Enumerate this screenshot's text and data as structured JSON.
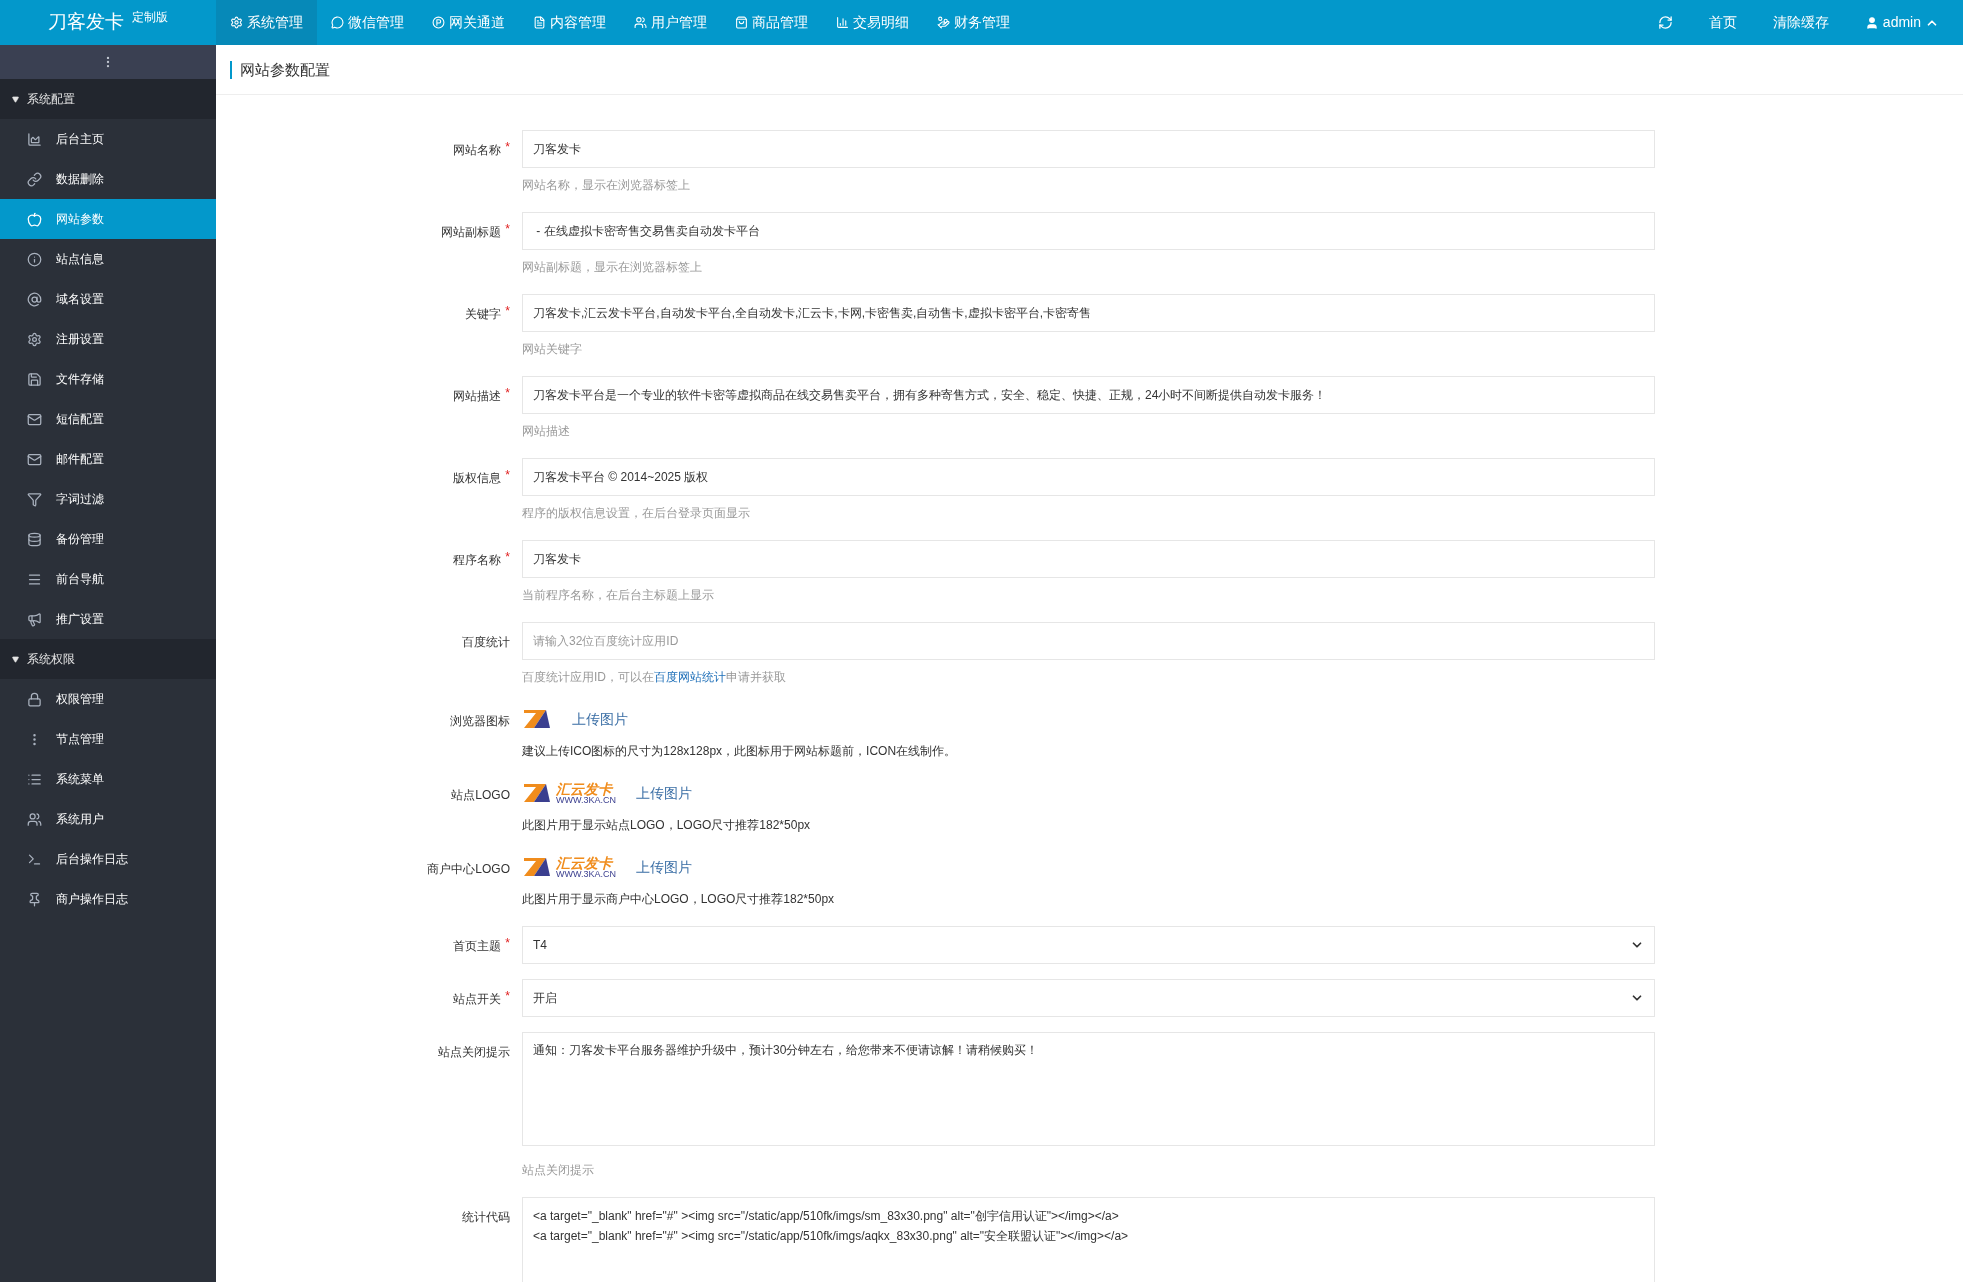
{
  "brand": {
    "name": "刀客发卡",
    "edition": "定制版"
  },
  "top_nav": [
    {
      "label": "系统管理",
      "selected": true
    },
    {
      "label": "微信管理",
      "selected": false
    },
    {
      "label": "网关通道",
      "selected": false
    },
    {
      "label": "内容管理",
      "selected": false
    },
    {
      "label": "用户管理",
      "selected": false
    },
    {
      "label": "商品管理",
      "selected": false
    },
    {
      "label": "交易明细",
      "selected": false
    },
    {
      "label": "财务管理",
      "selected": false
    }
  ],
  "top_right": {
    "home": "首页",
    "clear_cache": "清除缓存",
    "user": "admin"
  },
  "sidebar": [
    {
      "title": "系统配置",
      "expanded": true,
      "items": [
        {
          "label": "后台主页",
          "selected": false
        },
        {
          "label": "数据删除",
          "selected": false
        },
        {
          "label": "网站参数",
          "selected": true
        },
        {
          "label": "站点信息",
          "selected": false
        },
        {
          "label": "域名设置",
          "selected": false
        },
        {
          "label": "注册设置",
          "selected": false
        },
        {
          "label": "文件存储",
          "selected": false
        },
        {
          "label": "短信配置",
          "selected": false
        },
        {
          "label": "邮件配置",
          "selected": false
        },
        {
          "label": "字词过滤",
          "selected": false
        },
        {
          "label": "备份管理",
          "selected": false
        },
        {
          "label": "前台导航",
          "selected": false
        },
        {
          "label": "推广设置",
          "selected": false
        }
      ]
    },
    {
      "title": "系统权限",
      "expanded": true,
      "items": [
        {
          "label": "权限管理",
          "selected": false
        },
        {
          "label": "节点管理",
          "selected": false
        },
        {
          "label": "系统菜单",
          "selected": false
        },
        {
          "label": "系统用户",
          "selected": false
        },
        {
          "label": "后台操作日志",
          "selected": false
        },
        {
          "label": "商户操作日志",
          "selected": false
        }
      ]
    }
  ],
  "page_title": "网站参数配置",
  "form": [
    {
      "kind": "input",
      "label": "网站名称",
      "required_mark": "*",
      "value": "刀客发卡",
      "hint": [
        {
          "text": "网站名称，显示在浏览器标签上"
        }
      ]
    },
    {
      "kind": "input",
      "label": "网站副标题",
      "required_mark": "*",
      "value": " - 在线虚拟卡密寄售交易售卖自动发卡平台",
      "hint": [
        {
          "text": "网站副标题，显示在浏览器标签上"
        }
      ]
    },
    {
      "kind": "input",
      "label": "关键字",
      "required_mark": "*",
      "value": "刀客发卡,汇云发卡平台,自动发卡平台,全自动发卡,汇云卡,卡网,卡密售卖,自动售卡,虚拟卡密平台,卡密寄售",
      "hint": [
        {
          "text": "网站关键字"
        }
      ]
    },
    {
      "kind": "input",
      "label": "网站描述",
      "required_mark": "*",
      "value": "刀客发卡平台是一个专业的软件卡密等虚拟商品在线交易售卖平台，拥有多种寄售方式，安全、稳定、快捷、正规，24小时不间断提供自动发卡服务！",
      "hint": [
        {
          "text": "网站描述"
        }
      ]
    },
    {
      "kind": "input",
      "label": "版权信息",
      "required_mark": "*",
      "value": "刀客发卡平台 © 2014~2025 版权",
      "hint": [
        {
          "text": "程序的版权信息设置，在后台登录页面显示"
        }
      ]
    },
    {
      "kind": "input",
      "label": "程序名称",
      "required_mark": "*",
      "value": "刀客发卡",
      "hint": [
        {
          "text": "当前程序名称，在后台主标题上显示"
        }
      ]
    },
    {
      "kind": "input",
      "label": "百度统计",
      "placeholder": "请输入32位百度统计应用ID",
      "hint": [
        {
          "text": "百度统计应用ID，可以在"
        },
        {
          "text": "百度网站统计",
          "link": true
        },
        {
          "text": "申请并获取"
        }
      ]
    },
    {
      "kind": "upload",
      "label": "浏览器图标",
      "logo": {
        "kind": "mark"
      },
      "upload": "上传图片",
      "hint": [
        {
          "text": "建议上传ICO图标的尺寸为128x128px，此图标用于网站标题前，ICON在线制作。"
        }
      ]
    },
    {
      "kind": "upload",
      "label": "站点LOGO",
      "logo": {
        "kind": "full",
        "text": "汇云发卡",
        "sub": "WWW.3KA.CN"
      },
      "upload": "上传图片",
      "hint": [
        {
          "text": "此图片用于显示站点LOGO，LOGO尺寸推荐182*50px"
        }
      ]
    },
    {
      "kind": "upload",
      "label": "商户中心LOGO",
      "logo": {
        "kind": "full",
        "text": "汇云发卡",
        "sub": "WWW.3KA.CN"
      },
      "upload": "上传图片",
      "hint": [
        {
          "text": "此图片用于显示商户中心LOGO，LOGO尺寸推荐182*50px"
        }
      ]
    },
    {
      "kind": "select",
      "label": "首页主题",
      "required_mark": "*",
      "value": "T4"
    },
    {
      "kind": "select",
      "label": "站点开关",
      "required_mark": "*",
      "value": "开启"
    },
    {
      "kind": "textarea",
      "label": "站点关闭提示",
      "value": "通知：刀客发卡平台服务器维护升级中，预计30分钟左右，给您带来不便请谅解！请稍候购买！",
      "hint": [
        {
          "text": "站点关闭提示"
        }
      ]
    },
    {
      "kind": "code",
      "label": "统计代码",
      "value": "<a target=\"_blank\" href=\"#\" ><img src=\"/static/app/510fk/imgs/sm_83x30.png\" alt=\"创宇信用认证\"></img></a>\n<a target=\"_blank\" href=\"#\" ><img src=\"/static/app/510fk/imgs/aqkx_83x30.png\" alt=\"安全联盟认证\"></img></a>"
    }
  ]
}
